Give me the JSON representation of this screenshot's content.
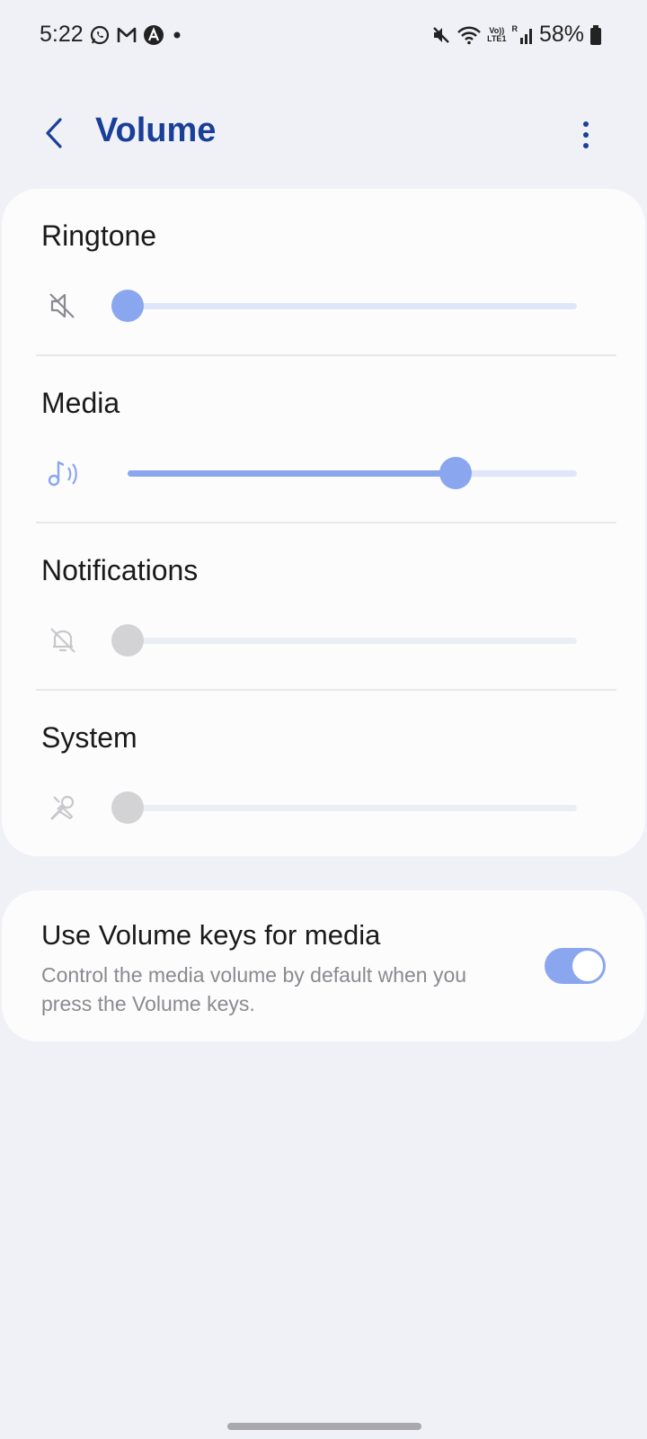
{
  "status_bar": {
    "time": "5:22",
    "battery": "58%",
    "lte_top": "Vo))",
    "lte_bottom": "LTE1",
    "sim_label": "R"
  },
  "header": {
    "title": "Volume"
  },
  "volume_rows": [
    {
      "label": "Ringtone",
      "level_percent": 0,
      "enabled": true,
      "icon": "speaker-muted-icon"
    },
    {
      "label": "Media",
      "level_percent": 73,
      "enabled": true,
      "icon": "music-note-icon"
    },
    {
      "label": "Notifications",
      "level_percent": 0,
      "enabled": false,
      "icon": "bell-muted-icon"
    },
    {
      "label": "System",
      "level_percent": 0,
      "enabled": false,
      "icon": "system-tools-icon"
    }
  ],
  "volume_keys": {
    "title": "Use Volume keys for media",
    "description": "Control the media volume by default when you press the Volume keys.",
    "enabled": true
  },
  "colors": {
    "accent": "#8aa6ef",
    "accent_track": "#dfe6fb",
    "disabled_thumb": "#d3d3d6",
    "disabled_track": "#eceef6",
    "title": "#1a3f99",
    "background": "#f0f1f6",
    "card": "#fcfcfd"
  }
}
